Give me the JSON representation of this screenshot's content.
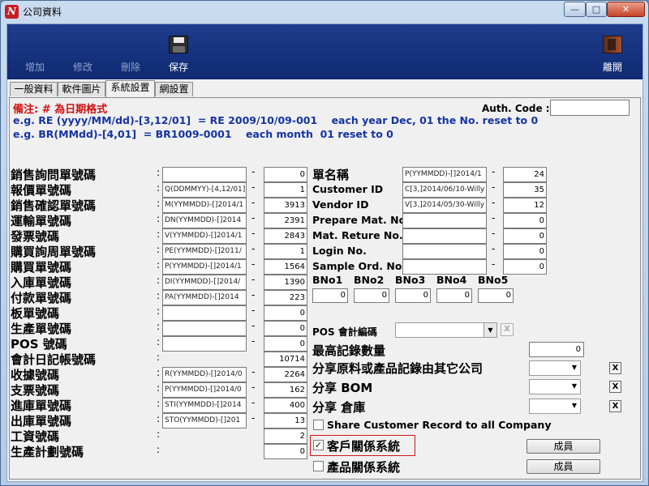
{
  "window": {
    "title": "公司資料",
    "app_icon": "N"
  },
  "toolbar": {
    "add": "增加",
    "edit": "修改",
    "delete": "刪除",
    "save": "保存",
    "exit": "離開"
  },
  "tabs": [
    "一般資料",
    "軟件圖片",
    "系統設置",
    "網設置"
  ],
  "notes": {
    "line1": "備注: # 為日期格式",
    "line2": "e.g. RE (yyyy/MM/dd)-[3,12/01]  = RE 2009/10/09-001    each year Dec, 01 the No. reset to 0",
    "line3": "e.g. BR(MMdd)-[4,01]  = BR1009-0001    each month  01 reset to 0"
  },
  "auth": {
    "label": "Auth. Code :",
    "value": ""
  },
  "left_rows": [
    {
      "label": "銷售詢問單號碼",
      "format": "",
      "number": "0"
    },
    {
      "label": "報價單號碼",
      "format": "Q(DDMMYY)-[4,12/01]",
      "number": "1"
    },
    {
      "label": "銷售確認單號碼",
      "format": "M(YYMMDD)-[]2014/1",
      "number": "3913"
    },
    {
      "label": "運輸單號碼",
      "format": "DN(YYMMDD)-[]2014",
      "number": "2391"
    },
    {
      "label": "發票號碼",
      "format": "V(YYMMDD)-[]2014/1",
      "number": "2843"
    },
    {
      "label": "購買詢周單號碼",
      "format": "PE(YYMMDD)-[]2011/",
      "number": "1"
    },
    {
      "label": "購買單號碼",
      "format": "P(YYMMDD)-[]2014/1",
      "number": "1564"
    },
    {
      "label": "入庫單號碼",
      "format": "DI(YYMMDD)-[]2014/",
      "number": "1390"
    },
    {
      "label": "付款單號碼",
      "format": "PA(YYMMDD)-[]2014",
      "number": "223"
    },
    {
      "label": "板單號碼",
      "format": "",
      "number": "0"
    },
    {
      "label": "生產單號碼",
      "format": "",
      "number": "0"
    },
    {
      "label": "POS 號碼",
      "format": "",
      "number": "0"
    },
    {
      "label": "會計日記帳號碼",
      "format": null,
      "number": "10714"
    },
    {
      "label": "收據號碼",
      "format": "R(YYMMDD)-[]2014/0",
      "number": "2264"
    },
    {
      "label": "支票號碼",
      "format": "P(YYMMDD)-[]2014/0",
      "number": "162"
    },
    {
      "label": "進庫單號碼",
      "format": "STI(YYMMDD)-[]2014",
      "number": "400"
    },
    {
      "label": "出庫單號碼",
      "format": "STO(YYMMDD)-[]201",
      "number": "13"
    },
    {
      "label": "工資號碼",
      "format": null,
      "number": "2"
    },
    {
      "label": "生產計劃號碼",
      "format": null,
      "number": "0"
    }
  ],
  "right_rows": [
    {
      "label": "單名稱",
      "format": "P(YYMMDD)-[]2014/1",
      "number": "24"
    },
    {
      "label": "Customer ID",
      "format": "C[3,]2014/06/10-Willy",
      "number": "35"
    },
    {
      "label": "Vendor ID",
      "format": "V[3,]2014/05/30-Willy",
      "number": "12"
    },
    {
      "label": "Prepare Mat. No.",
      "format": "",
      "number": "0"
    },
    {
      "label": "Mat. Reture No.",
      "format": "",
      "number": "0"
    },
    {
      "label": "Login No.",
      "format": "",
      "number": "0"
    },
    {
      "label": "Sample Ord. No.",
      "format": "",
      "number": "0"
    }
  ],
  "bno": [
    {
      "label": "BNo1",
      "value": "0"
    },
    {
      "label": "BNo2",
      "value": "0"
    },
    {
      "label": "BNo3",
      "value": "0"
    },
    {
      "label": "BNo4",
      "value": "0"
    },
    {
      "label": "BNo5",
      "value": "0"
    }
  ],
  "pos_account": {
    "label": "POS 會計編碼",
    "value": "",
    "clear": "X"
  },
  "max_records": {
    "label": "最高記錄數量",
    "value": "0"
  },
  "share": {
    "material": "分享原料或產品記錄由其它公司",
    "bom": "分享 BOM",
    "warehouse": "分享 倉庫",
    "clear": "X"
  },
  "checkboxes": {
    "share_customer": {
      "label": "Share Customer Record to all Company",
      "checked": false
    },
    "customer_relation": {
      "label": "客戶關係系統",
      "checked": true
    },
    "product_relation": {
      "label": "產品關係系統",
      "checked": false
    }
  },
  "member_button": "成員",
  "colors": {
    "toolbar": "#1a3585",
    "note_red": "#d01010",
    "note_blue": "#1533a3",
    "highlight": "#d01818"
  }
}
